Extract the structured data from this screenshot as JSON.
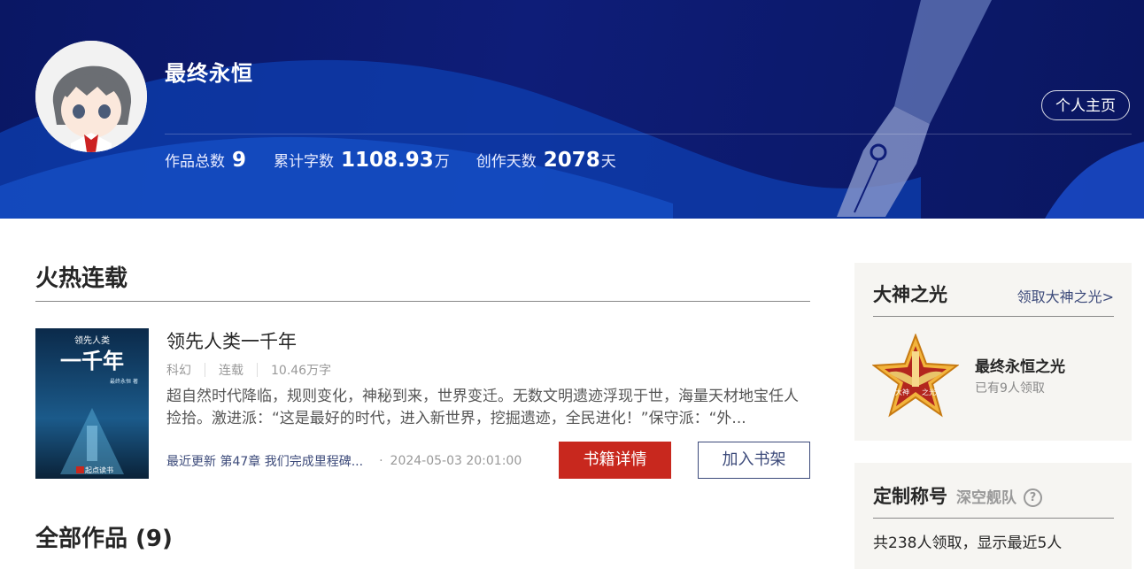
{
  "author": {
    "name": "最终永恒",
    "home_label": "个人主页"
  },
  "stats": [
    {
      "label": "作品总数",
      "value": "9",
      "unit": ""
    },
    {
      "label": "累计字数",
      "value": "1108.93",
      "unit": "万"
    },
    {
      "label": "创作天数",
      "value": "2078",
      "unit": "天"
    }
  ],
  "hot": {
    "section_title": "火热连载",
    "book": {
      "cover_text_top": "领先人类",
      "cover_text_main": "一千年",
      "cover_author": "最终永恒 著",
      "cover_brand": "起点读书",
      "title": "领先人类一千年",
      "genre": "科幻",
      "status": "连载",
      "words": "10.46万字",
      "description": "超自然时代降临，规则变化，神秘到来，世界变迁。无数文明遗迹浮现于世，海量天材地宝任人捡拾。激进派：“这是最好的时代，进入新世界，挖掘遗迹，全民进化！”保守派：“外...",
      "latest_update": "最近更新 第47章 我们完成里程碑...",
      "update_time": "2024-05-03 20:01:00",
      "details_label": "书籍详情",
      "shelf_label": "加入书架"
    }
  },
  "all_works_title": "全部作品 (9)",
  "sidebar": {
    "glory": {
      "title": "大神之光",
      "link": "领取大神之光>",
      "badge_text_left": "大神",
      "badge_text_right": "之光",
      "badge_name": "最终永恒之光",
      "badge_sub": "已有9人领取"
    },
    "custom": {
      "title": "定制称号",
      "tag": "深空舰队",
      "help_symbol": "?",
      "text": "共238人领取，显示最近5人"
    }
  }
}
